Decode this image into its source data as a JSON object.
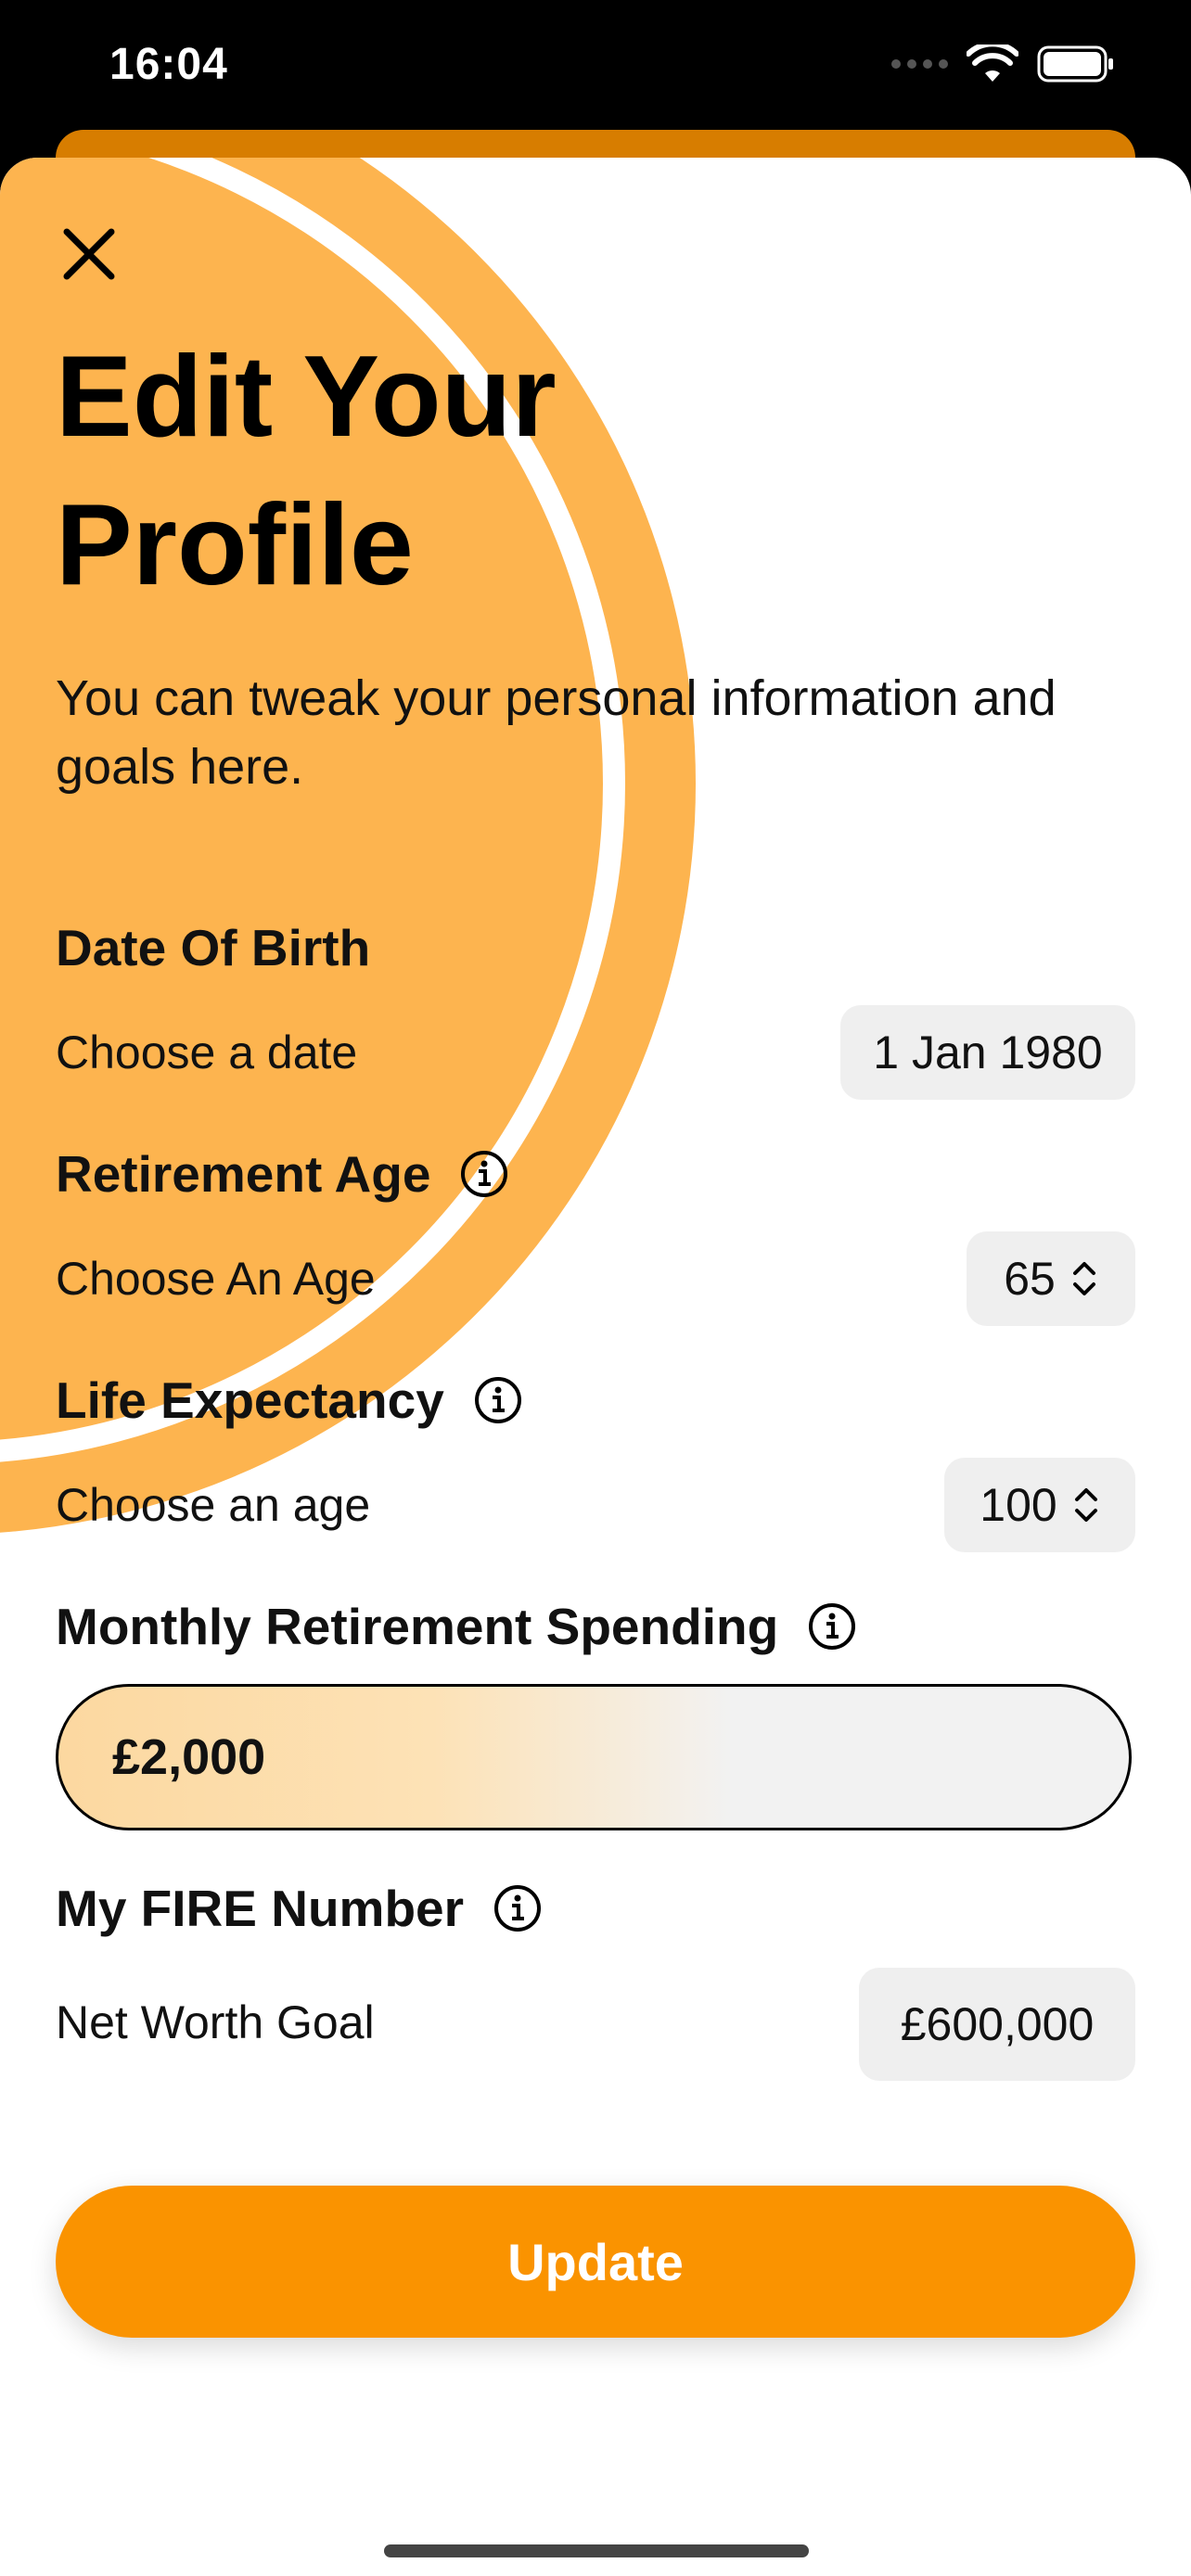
{
  "status_bar": {
    "time": "16:04"
  },
  "header": {
    "title": "Edit Your Profile",
    "subtitle": "You can tweak your personal information and goals here."
  },
  "fields": {
    "dob": {
      "label": "Date Of Birth",
      "sublabel": "Choose a date",
      "value": "1 Jan 1980"
    },
    "retirement_age": {
      "label": "Retirement Age",
      "sublabel": "Choose An Age",
      "value": "65"
    },
    "life_expectancy": {
      "label": "Life Expectancy",
      "sublabel": "Choose an age",
      "value": "100"
    },
    "monthly_spending": {
      "label": "Monthly Retirement Spending",
      "value": "£2,000"
    },
    "fire_number": {
      "label": "My FIRE Number",
      "sublabel": "Net Worth Goal",
      "value": "£600,000"
    }
  },
  "actions": {
    "update_label": "Update"
  },
  "colors": {
    "accent": "#FA9300",
    "decor": "#FDB44F",
    "peek_card": "#D77D00"
  },
  "icons": [
    "close-icon",
    "info-icon",
    "chevron-updown-icon",
    "wifi-icon",
    "battery-icon"
  ]
}
